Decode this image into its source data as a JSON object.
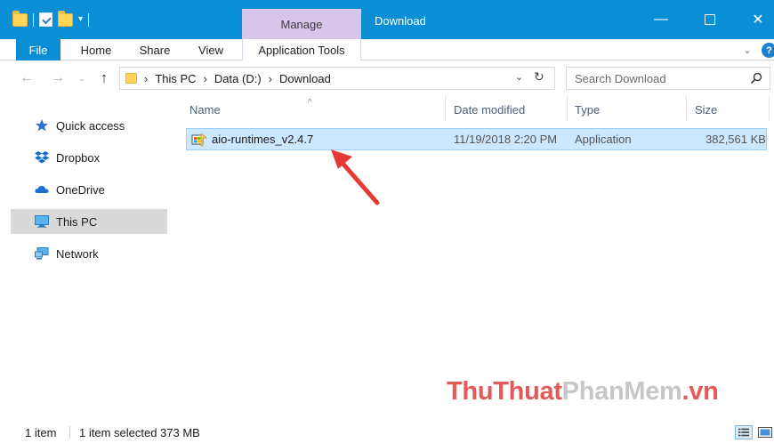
{
  "window": {
    "title": "Download",
    "context_tab": "Manage",
    "controls": {
      "minimize": "—",
      "maximize": "",
      "close": "✕"
    }
  },
  "ribbon": {
    "tabs": [
      "File",
      "Home",
      "Share",
      "View",
      "Application Tools"
    ],
    "collapse": "⌄",
    "help": "?"
  },
  "address": {
    "back": "←",
    "forward": "→",
    "recent": "⌄",
    "up": "↑",
    "crumbs": [
      "This PC",
      "Data (D:)",
      "Download"
    ],
    "chevron": "›",
    "dropdown": "⌄",
    "refresh": "↻"
  },
  "search": {
    "placeholder": "Search Download"
  },
  "navpane": {
    "items": [
      {
        "label": "Quick access",
        "icon": "star-icon",
        "selected": false
      },
      {
        "label": "Dropbox",
        "icon": "dropbox-icon",
        "selected": false
      },
      {
        "label": "OneDrive",
        "icon": "cloud-icon",
        "selected": false
      },
      {
        "label": "This PC",
        "icon": "monitor-icon",
        "selected": true
      },
      {
        "label": "Network",
        "icon": "network-icon",
        "selected": false
      }
    ]
  },
  "columns": {
    "name": "Name",
    "date": "Date modified",
    "type": "Type",
    "size": "Size",
    "sort_caret": "^"
  },
  "files": [
    {
      "name": "aio-runtimes_v2.4.7",
      "date": "11/19/2018 2:20 PM",
      "type": "Application",
      "size": "382,561 KB",
      "icon": "installer-app-icon",
      "selected": true
    }
  ],
  "status": {
    "count": "1 item",
    "selection": "1 item selected  373 MB"
  },
  "watermark": {
    "part1": "ThuThuat",
    "part2": "PhanMem",
    "part3": ".vn"
  },
  "colors": {
    "titlebar": "#0a8fd6",
    "manage_tab": "#d8c5ec",
    "selection": "#cce8ff",
    "arrow": "#e53935"
  }
}
